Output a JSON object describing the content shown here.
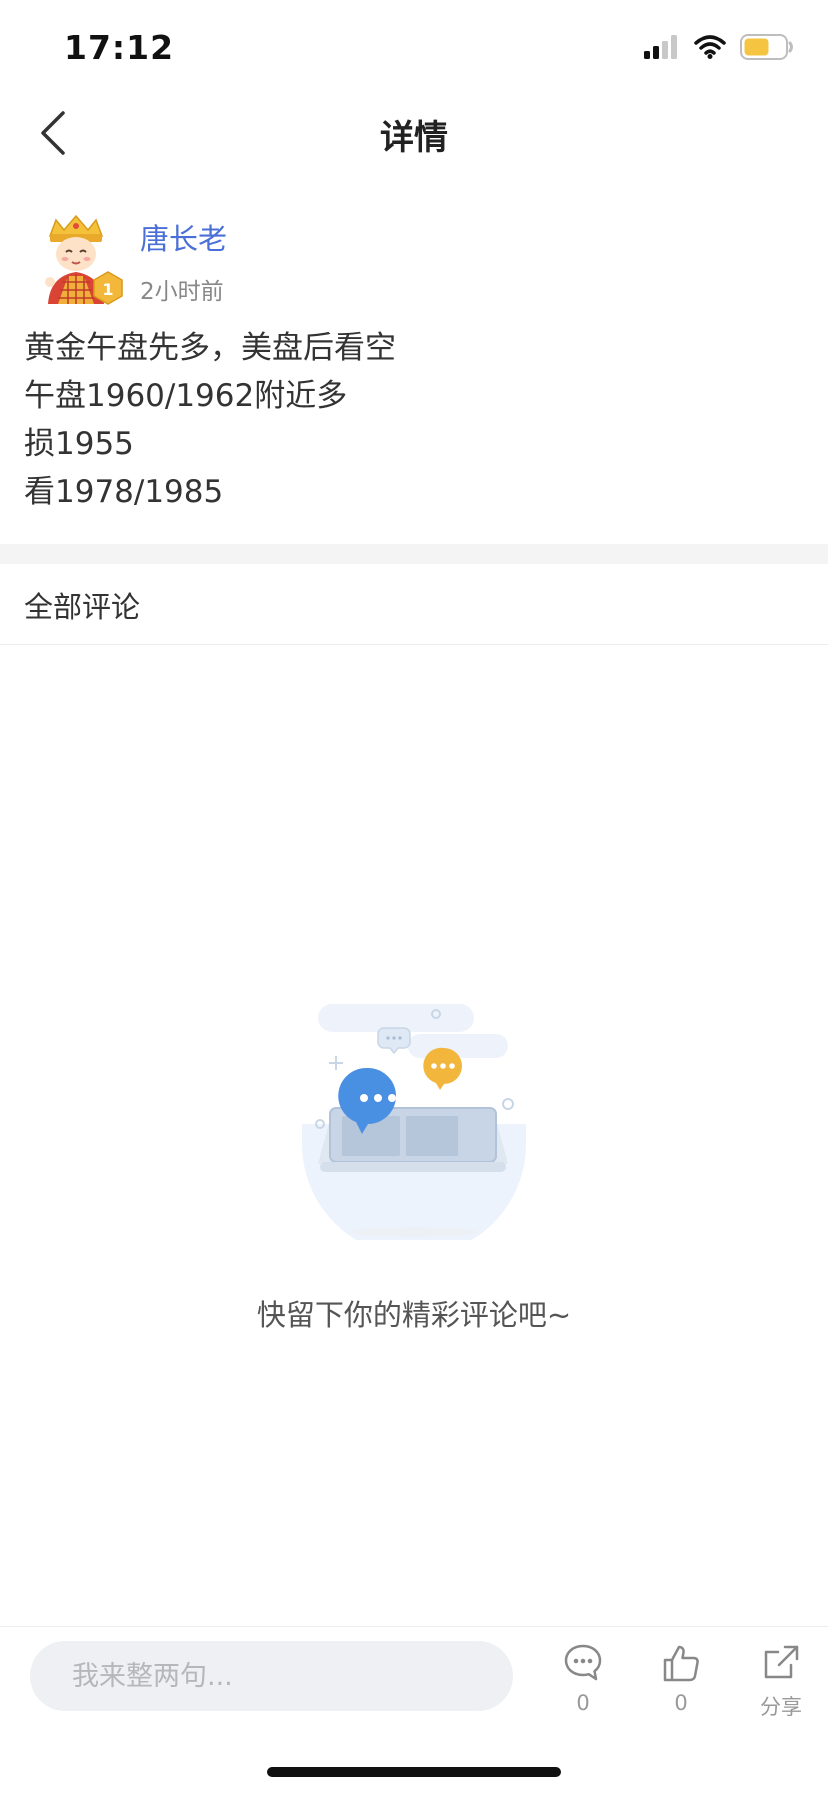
{
  "status_bar": {
    "time": "17:12",
    "icons": [
      "cellular-signal-icon",
      "wifi-icon",
      "battery-icon"
    ],
    "battery_color": "#f5c542"
  },
  "nav": {
    "title": "详情",
    "back_icon": "chevron-left-icon"
  },
  "post": {
    "author": "唐长老",
    "time": "2小时前",
    "avatar_icon": "monk-avatar-icon",
    "badge": "1",
    "lines": [
      "黄金午盘先多，美盘后看空",
      "午盘1960/1962附近多",
      "损1955",
      "看1978/1985"
    ]
  },
  "comments": {
    "header": "全部评论",
    "empty_text": "快留下你的精彩评论吧~",
    "empty_icon": "empty-comments-illustration-icon"
  },
  "bottom_bar": {
    "input_placeholder": "我来整两句...",
    "comment_count": "0",
    "like_count": "0",
    "share_label": "分享"
  },
  "colors": {
    "author_name": "#4a6fd6",
    "bubble_blue": "#4a90e2",
    "bubble_orange": "#f2b63c",
    "input_bg": "#eef0f3"
  }
}
